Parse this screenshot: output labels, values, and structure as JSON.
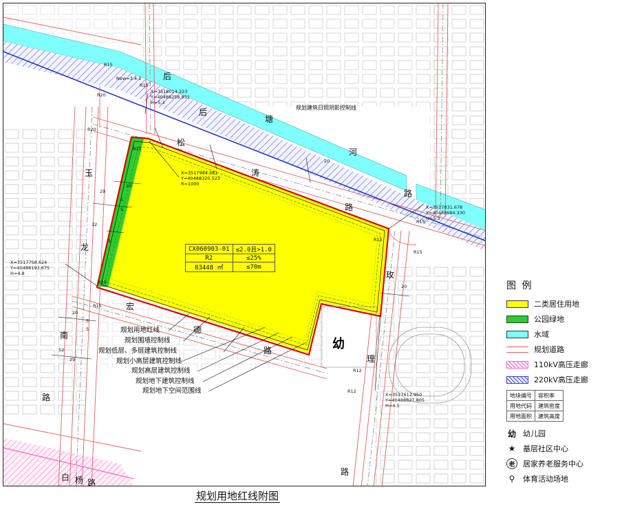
{
  "caption": "规划用地红线附图",
  "colors": {
    "residential": "#ffff00",
    "green": "#2ecc2e",
    "water": "#80ffff",
    "red_line": "#e00000",
    "road": "#e06060",
    "hv110": "#ff66cc",
    "hv220": "#3344dd"
  },
  "parcel_table": [
    [
      "CX060903-01",
      "≤2.0且>1.0"
    ],
    [
      "R2",
      "≤25%"
    ],
    [
      "83448 ㎡",
      "≤70m"
    ]
  ],
  "road_chars": {
    "hou": [
      "后",
      "后"
    ],
    "songtao": [
      "松",
      "涛",
      "路"
    ],
    "houtang": [
      "塘",
      "河"
    ],
    "road2": [
      "路"
    ],
    "yulong": [
      "玉",
      "龙"
    ],
    "nan": [
      "南"
    ],
    "lu_left": [
      "路"
    ],
    "hongde": [
      "宏",
      "德",
      "路"
    ],
    "mei": [
      "玫"
    ],
    "li": [
      "理"
    ],
    "lu_bottom": [
      "路"
    ],
    "baiyang": [
      "白",
      "杨",
      "路"
    ]
  },
  "coords": {
    "c1": "X=3518014.223\nY=40488256.951\nH=5.3",
    "c2": "X=3517984.381\nY=40488320.523\nR=1000",
    "c3": "X=3517831.678\nY=40488684.330\nH=5.3",
    "c4": "X=3517758.624\nY=40488193.675\nH=4.8",
    "c5": "X=3517612.950\nY=40488627.805\nH=4.5"
  },
  "radius_labels": [
    "R15",
    "R20",
    "R20",
    "R15",
    "R15",
    "R15",
    "R15",
    "R15",
    "R15",
    "R12",
    "R12",
    "R15"
  ],
  "dim_labels": [
    "20",
    "5",
    "5",
    "29",
    "32",
    "5",
    "20",
    "5",
    "5",
    "29",
    "52",
    "20",
    "20"
  ],
  "line_notes": {
    "setback": "规划建筑日照阴影控制线",
    "new": "New=3.4-1"
  },
  "leaders": [
    "规划用地红线",
    "规划围墙控制线",
    "规划低层、多层建筑控制线",
    "规划小高层建筑控制线",
    "规划高层建筑控制线",
    "规划地下建筑控制线",
    "规划地下空间范围线"
  ],
  "kindergarten_mark": "幼",
  "legend": {
    "title": "图  例",
    "items": [
      {
        "label": "二类居住用地",
        "color": "#ffff00"
      },
      {
        "label": "公园绿地",
        "color": "#2ecc2e"
      },
      {
        "label": "水域",
        "color": "#80ffff"
      },
      {
        "label": "规划道路",
        "color": "#ffffff"
      },
      {
        "label": "110kV高压走廊",
        "color": "#ffccee"
      },
      {
        "label": "220kV高压走廊",
        "color": "#ccd0ff"
      }
    ],
    "mini_table": [
      [
        "地块编号",
        "容积率"
      ],
      [
        "用地代码",
        "建筑密度"
      ],
      [
        "用地面积",
        "建筑高度"
      ]
    ],
    "symbols": [
      {
        "icon": "幼",
        "label": "幼儿园",
        "name": "kindergarten-icon"
      },
      {
        "icon": "★",
        "label": "基层社区中心",
        "name": "star-icon"
      },
      {
        "icon": "老",
        "label": "居家养老服务中心",
        "name": "elderly-care-icon"
      },
      {
        "icon": "⚲",
        "label": "体育活动场地",
        "name": "sports-icon"
      }
    ]
  }
}
